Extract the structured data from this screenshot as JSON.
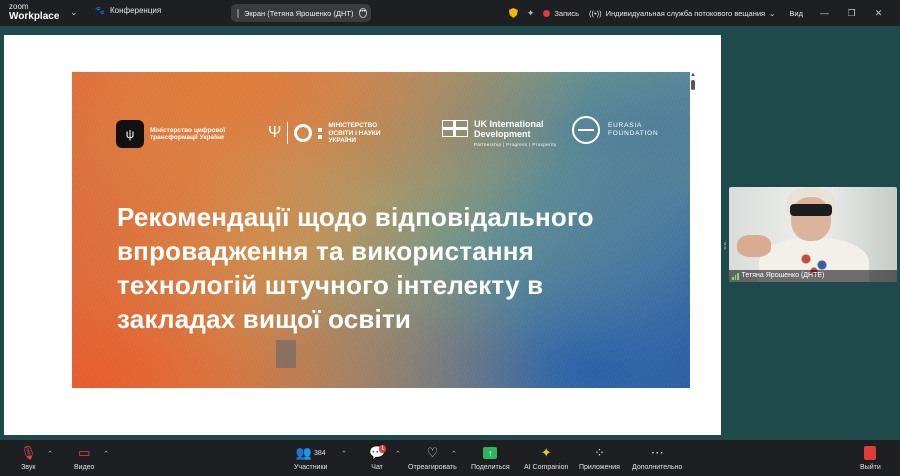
{
  "app": {
    "brand_small": "zoom",
    "brand_big": "Workplace"
  },
  "topbar": {
    "conference_label": "Конференция",
    "screen_pill_label": "Экран (Тетяна Ярошенко (ДНТ)",
    "record_label": "Запись",
    "live_label": "Индивидуальная служба потокового вещания",
    "view_label": "Вид"
  },
  "slide": {
    "title": "Рекомендації щодо відповідального впровадження та використання технологій штучного інтелекту в закладах вищої освіти",
    "logo_mdt": "Міністерство цифрової трансформації України",
    "logo_mon": "МІНІСТЕРСТВО ОСВІТИ І НАУКИ УКРАЇНИ",
    "logo_uk_line1": "UK International",
    "logo_uk_line2": "Development",
    "logo_uk_tag": "Partnership  |  Progress  |  Prosperity",
    "logo_eurasia_line1": "EURASIA",
    "logo_eurasia_line2": "FOUNDATION"
  },
  "video": {
    "name": "Тетяна Ярошенко (ДНТЕ)"
  },
  "toolbar": {
    "audio": "Звук",
    "video": "Видео",
    "participants": "Участники",
    "participants_count": "384",
    "chat": "Чат",
    "chat_badge": "1",
    "react": "Отреагировать",
    "share": "Поделиться",
    "ai": "AI Companion",
    "apps": "Приложения",
    "more": "Дополнительно",
    "leave": "Выйти"
  },
  "colors": {
    "record": "#e03b3b",
    "share": "#2db55d",
    "ai": "#e8c53a",
    "shield": "#f2b600"
  }
}
